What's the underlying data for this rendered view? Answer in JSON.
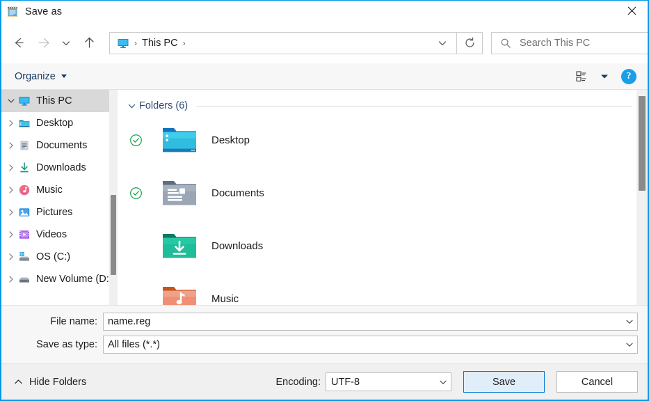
{
  "window": {
    "title": "Save as",
    "app_icon": "notepad-icon",
    "close_label": "✕",
    "border_color": "#0099e5"
  },
  "nav": {
    "back": {
      "icon": "back-arrow-icon",
      "enabled": true
    },
    "forward": {
      "icon": "forward-arrow-icon",
      "enabled": false
    },
    "recent": {
      "icon": "chevron-down-icon"
    },
    "up": {
      "icon": "up-arrow-icon",
      "enabled": true
    },
    "refresh": {
      "icon": "refresh-icon"
    }
  },
  "address": {
    "root_icon": "this-pc-monitor-icon",
    "separator": "›",
    "crumbs": [
      "This PC"
    ],
    "dropdown_icon": "chevron-down-icon"
  },
  "search": {
    "icon": "search-icon",
    "placeholder": "Search This PC",
    "value": ""
  },
  "toolbar": {
    "organize_label": "Organize",
    "organize_caret": "chevron-down-icon",
    "view_icon": "view-layout-icon",
    "view_caret": "chevron-down-icon",
    "help_label": "?",
    "help_icon": "help-circle-icon"
  },
  "sidebar": {
    "items": [
      {
        "label": "This PC",
        "icon": "this-pc-monitor-icon",
        "selected": true,
        "expanded": true,
        "indent": 0
      },
      {
        "label": "Desktop",
        "icon": "desktop-folder-icon",
        "selected": false,
        "expanded": false,
        "indent": 1
      },
      {
        "label": "Documents",
        "icon": "documents-folder-icon",
        "selected": false,
        "expanded": false,
        "indent": 1
      },
      {
        "label": "Downloads",
        "icon": "downloads-folder-icon",
        "selected": false,
        "expanded": false,
        "indent": 1
      },
      {
        "label": "Music",
        "icon": "music-folder-icon",
        "selected": false,
        "expanded": false,
        "indent": 1
      },
      {
        "label": "Pictures",
        "icon": "pictures-folder-icon",
        "selected": false,
        "expanded": false,
        "indent": 1
      },
      {
        "label": "Videos",
        "icon": "videos-folder-icon",
        "selected": false,
        "expanded": false,
        "indent": 1
      },
      {
        "label": "OS (C:)",
        "icon": "os-drive-icon",
        "selected": false,
        "expanded": false,
        "indent": 1
      },
      {
        "label": "New Volume (D:)",
        "icon": "drive-icon",
        "selected": false,
        "expanded": false,
        "indent": 1
      }
    ],
    "scrollbar": {
      "thumb_top_pct": 49,
      "thumb_height_pct": 37
    }
  },
  "content": {
    "group_title": "Folders (6)",
    "group_chevron": "chevron-down-icon",
    "items": [
      {
        "label": "Desktop",
        "icon": "desktop-folder-icon",
        "sync": "synced-check-icon"
      },
      {
        "label": "Documents",
        "icon": "documents-folder-icon",
        "sync": "synced-check-icon"
      },
      {
        "label": "Downloads",
        "icon": "downloads-folder-icon",
        "sync": ""
      },
      {
        "label": "Music",
        "icon": "music-folder-icon",
        "sync": ""
      }
    ],
    "scrollbar": {
      "thumb_top_pct": 3,
      "thumb_height_pct": 44
    }
  },
  "form": {
    "filename_label": "File name:",
    "filename_value": "name.reg",
    "filename_arrow": "chevron-down-icon",
    "savetype_label": "Save as type:",
    "savetype_value": "All files  (*.*)",
    "savetype_arrow": "chevron-down-icon"
  },
  "footer": {
    "hide_folders_label": "Hide Folders",
    "hide_folders_icon": "chevron-up-icon",
    "encoding_label": "Encoding:",
    "encoding_value": "UTF-8",
    "encoding_arrow": "chevron-down-icon",
    "save_label": "Save",
    "cancel_label": "Cancel"
  },
  "colors": {
    "accent": "#0078d4",
    "border": "#0099e5",
    "primary_button_fill": "#e0eef9",
    "selected_row": "#d9d9d9",
    "group_title": "#2e4a73",
    "sync_green": "#16a34a"
  }
}
